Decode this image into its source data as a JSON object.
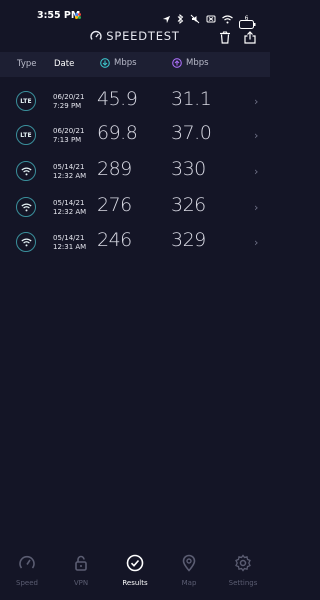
{
  "status_bar": {
    "time": "3:55 PM",
    "icons": [
      "location-icon",
      "bluetooth-icon",
      "mute-icon",
      "sim-off-icon",
      "wifi-icon",
      "battery-icon"
    ],
    "battery": "6"
  },
  "app": {
    "brand": "SPEEDTEST",
    "accent_download": "#3cc2c9",
    "accent_upload": "#a86df4"
  },
  "table": {
    "headers": {
      "type": "Type",
      "date": "Date",
      "download": "Mbps",
      "upload": "Mbps"
    },
    "rows": [
      {
        "type": "LTE",
        "date": "06/20/21",
        "time": "7:29 PM",
        "download": "45.9",
        "upload": "31.1"
      },
      {
        "type": "LTE",
        "date": "06/20/21",
        "time": "7:13 PM",
        "download": "69.8",
        "upload": "37.0"
      },
      {
        "type": "wifi",
        "date": "05/14/21",
        "time": "12:32 AM",
        "download": "289",
        "upload": "330"
      },
      {
        "type": "wifi",
        "date": "05/14/21",
        "time": "12:32 AM",
        "download": "276",
        "upload": "326"
      },
      {
        "type": "wifi",
        "date": "05/14/21",
        "time": "12:31 AM",
        "download": "246",
        "upload": "329"
      }
    ]
  },
  "nav": {
    "items": [
      {
        "label": "Speed",
        "icon": "speedometer-icon"
      },
      {
        "label": "VPN",
        "icon": "lock-icon"
      },
      {
        "label": "Results",
        "icon": "check-circle-icon",
        "active": true
      },
      {
        "label": "Map",
        "icon": "map-pin-icon"
      },
      {
        "label": "Settings",
        "icon": "gear-icon"
      }
    ]
  }
}
